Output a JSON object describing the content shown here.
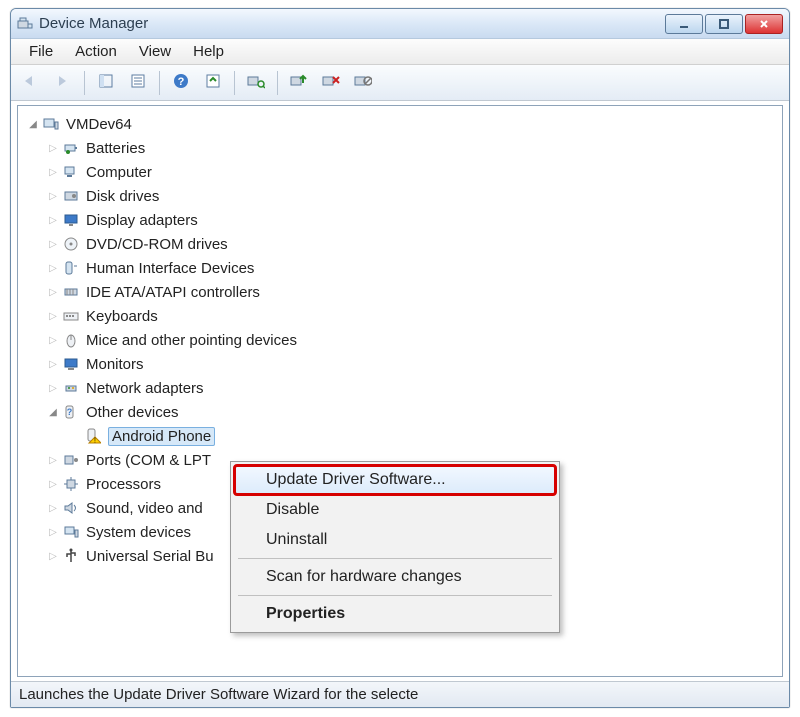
{
  "titlebar": {
    "title": "Device Manager"
  },
  "menu": {
    "file": "File",
    "action": "Action",
    "view": "View",
    "help": "Help"
  },
  "toolbar": {
    "back": "back",
    "forward": "forward",
    "show_hidden": "show-hidden",
    "properties": "properties",
    "help": "help",
    "refresh": "refresh",
    "scan": "scan",
    "update": "update-driver",
    "uninstall": "uninstall",
    "disable": "disable"
  },
  "tree": {
    "root": "VMDev64",
    "items": [
      {
        "label": "Batteries",
        "icon": "battery-icon"
      },
      {
        "label": "Computer",
        "icon": "computer-icon"
      },
      {
        "label": "Disk drives",
        "icon": "disk-icon"
      },
      {
        "label": "Display adapters",
        "icon": "display-icon"
      },
      {
        "label": "DVD/CD-ROM drives",
        "icon": "disc-icon"
      },
      {
        "label": "Human Interface Devices",
        "icon": "hid-icon"
      },
      {
        "label": "IDE ATA/ATAPI controllers",
        "icon": "ide-icon"
      },
      {
        "label": "Keyboards",
        "icon": "keyboard-icon"
      },
      {
        "label": "Mice and other pointing devices",
        "icon": "mouse-icon"
      },
      {
        "label": "Monitors",
        "icon": "monitor-icon"
      },
      {
        "label": "Network adapters",
        "icon": "network-icon"
      },
      {
        "label": "Other devices",
        "icon": "unknown-icon",
        "expanded": true,
        "children": [
          {
            "label": "Android Phone",
            "icon": "warning-device-icon",
            "selected": true
          }
        ]
      },
      {
        "label": "Ports (COM & LPT",
        "icon": "port-icon"
      },
      {
        "label": "Processors",
        "icon": "cpu-icon"
      },
      {
        "label": "Sound, video and",
        "icon": "sound-icon"
      },
      {
        "label": "System devices",
        "icon": "system-icon"
      },
      {
        "label": "Universal Serial Bu",
        "icon": "usb-icon"
      }
    ]
  },
  "context_menu": {
    "items": [
      {
        "label": "Update Driver Software...",
        "hover": true,
        "highlight": true
      },
      {
        "label": "Disable"
      },
      {
        "label": "Uninstall"
      },
      {
        "sep": true
      },
      {
        "label": "Scan for hardware changes"
      },
      {
        "sep": true
      },
      {
        "label": "Properties",
        "bold": true
      }
    ]
  },
  "statusbar": {
    "text": "Launches the Update Driver Software Wizard for the selecte"
  }
}
